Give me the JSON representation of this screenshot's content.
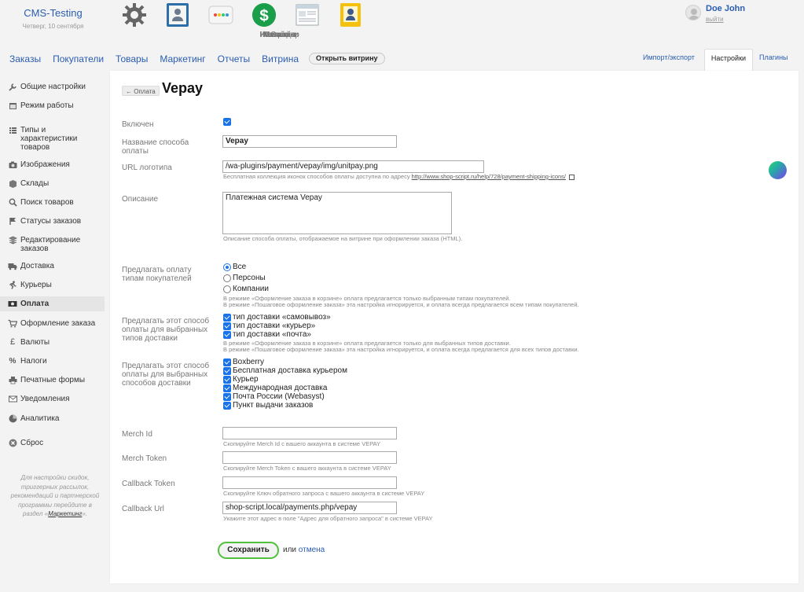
{
  "header": {
    "app_name": "CMS-Testing",
    "date": "Четверг, 10 сентября",
    "apps": [
      {
        "label": "Настройки",
        "icon": "gear-icon"
      },
      {
        "label": "Контакты",
        "icon": "contacts-icon"
      },
      {
        "label": "Инсталлер",
        "icon": "installer-icon"
      },
      {
        "label": "Магазин",
        "icon": "shop-dollar-icon",
        "active": true
      },
      {
        "label": "Сайт",
        "icon": "site-icon"
      },
      {
        "label": "Команда",
        "icon": "team-icon"
      }
    ],
    "user": {
      "name": "Doe John",
      "logout": "выйти"
    }
  },
  "nav": {
    "links": [
      "Заказы",
      "Покупатели",
      "Товары",
      "Маркетинг",
      "Отчеты",
      "Витрина"
    ],
    "open_storefront": "Открыть витрину",
    "right_tabs": [
      {
        "label": "Импорт/экспорт"
      },
      {
        "label": "Настройки",
        "active": true
      },
      {
        "label": "Плагины"
      }
    ]
  },
  "sidebar": {
    "items": [
      {
        "label": "Общие настройки",
        "icon": "wrench-icon"
      },
      {
        "label": "Режим работы",
        "icon": "calendar-icon"
      },
      {
        "label": "Типы и характеристики товаров",
        "icon": "list-icon"
      },
      {
        "label": "Изображения",
        "icon": "camera-icon"
      },
      {
        "label": "Склады",
        "icon": "box-icon"
      },
      {
        "label": "Поиск товаров",
        "icon": "search-icon"
      },
      {
        "label": "Статусы заказов",
        "icon": "flag-icon"
      },
      {
        "label": "Редактирование заказов",
        "icon": "layers-icon"
      },
      {
        "label": "Доставка",
        "icon": "truck-icon"
      },
      {
        "label": "Курьеры",
        "icon": "runner-icon"
      },
      {
        "label": "Оплата",
        "icon": "money-icon",
        "active": true
      },
      {
        "label": "Оформление заказа",
        "icon": "cart-icon"
      },
      {
        "label": "Валюты",
        "icon": "pound-icon"
      },
      {
        "label": "Налоги",
        "icon": "percent-icon"
      },
      {
        "label": "Печатные формы",
        "icon": "printer-icon"
      },
      {
        "label": "Уведомления",
        "icon": "envelope-icon"
      },
      {
        "label": "Аналитика",
        "icon": "chart-icon"
      },
      {
        "label": "Сброс",
        "icon": "reset-icon"
      }
    ],
    "note_text": "Для настройки скидок, триггерных рассылок, рекомендаций и партнерской программы перейдите в раздел «",
    "note_link": "Маркетинг",
    "note_tail": "»."
  },
  "page": {
    "back": "← Оплата",
    "title": "Vepay"
  },
  "form": {
    "enabled_label": "Включен",
    "enabled": true,
    "name_label": "Название способа оплаты",
    "name_value": "Vepay",
    "logo_label": "URL логотипа",
    "logo_value": "/wa-plugins/payment/vepay/img/unitpay.png",
    "logo_hint": "Бесплатная коллекция иконок способов оплаты доступна по адресу ",
    "logo_hint_link": "http://www.shop-script.ru/help/728/payment-shipping-icons/",
    "desc_label": "Описание",
    "desc_value": "Платежная система Vepay",
    "desc_hint": "Описание способа оплаты, отображаемое на витрине при оформлении заказа (HTML).",
    "customer_label": "Предлагать оплату типам покупателей",
    "customer_options": [
      "Все",
      "Персоны",
      "Компании"
    ],
    "customer_selected": "Все",
    "customer_hint1": "В режиме «Оформление заказа в корзине» оплата предлагается только выбранным типам покупателей.",
    "customer_hint2": "В режиме «Пошаговое оформление заказа» эта настройка игнорируется, и оплата всегда предлагается всем типам покупателей.",
    "shiptype_label": "Предлагать этот способ оплаты для выбранных типов доставки",
    "shiptype_options": [
      "тип доставки «самовывоз»",
      "тип доставки «курьер»",
      "тип доставки «почта»"
    ],
    "shiptype_hint1": "В режиме «Оформление заказа в корзине» оплата предлагается только для выбранных типов доставки.",
    "shiptype_hint2": "В режиме «Пошаговое оформление заказа» эта настройка игнорируется, и оплата всегда предлагается для всех типов доставки.",
    "shipmethod_label": "Предлагать этот способ оплаты для выбранных способов доставки",
    "shipmethod_options": [
      "Boxberry",
      "Бесплатная доставка курьером",
      "Курьер",
      "Международная доставка",
      "Почта России (Webasyst)",
      "Пункт выдачи заказов"
    ],
    "merch_id_label": "Merch Id",
    "merch_id_value": "",
    "merch_id_hint": "Скопируйте Merch Id с вашего аккаунта в системе VEPAY",
    "merch_token_label": "Merch Token",
    "merch_token_value": "",
    "merch_token_hint": "Скопируйте Merch Token с вашего аккаунта в системе VEPAY",
    "callback_token_label": "Callback Token",
    "callback_token_value": "",
    "callback_token_hint": "Скопируйте Ключ обратного запроса с вашего аккаунта в системе VEPAY",
    "callback_url_label": "Callback Url",
    "callback_url_value": "shop-script.local/payments.php/vepay",
    "callback_url_hint": "Укажите этот адрес в поле \"Адрес для обратного запроса\" в системе VEPAY",
    "save": "Сохранить",
    "or": "или",
    "cancel": "отмена"
  },
  "colors": {
    "accent": "#2a5db0",
    "checkbox": "#1a73e8",
    "save_border": "#51c13d"
  }
}
